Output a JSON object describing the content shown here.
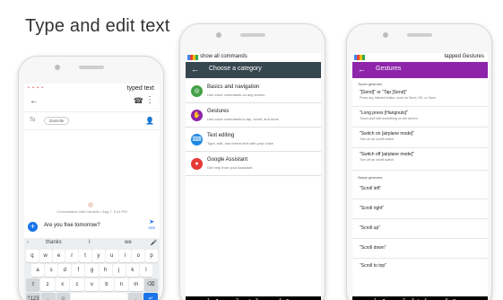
{
  "headline": "Type and edit text",
  "phone1": {
    "overlay_text": "typed text",
    "to_label": "To",
    "recipient_chip": "Danielle",
    "conversation_note": "Conversation with Danielle • Aug 7, 5:44 PM",
    "message_draft": "Are you free tomorrow?",
    "send_label": "SMS",
    "suggestions": [
      "thanks",
      "I",
      "we"
    ],
    "keyboard": {
      "row1": [
        "q",
        "w",
        "e",
        "r",
        "t",
        "y",
        "u",
        "i",
        "o",
        "p"
      ],
      "row2": [
        "a",
        "s",
        "d",
        "f",
        "g",
        "h",
        "j",
        "k",
        "l"
      ],
      "row3": [
        "⇧",
        "z",
        "x",
        "c",
        "v",
        "b",
        "n",
        "m",
        "⌫"
      ],
      "row4": [
        "?123",
        ",",
        "☺",
        "",
        ".",
        " ↵"
      ]
    }
  },
  "phone2": {
    "top_text": "show all commands",
    "title": "Choose a category",
    "categories": [
      {
        "title": "Basics and navigation",
        "desc": "Use voice commands on any screen",
        "color": "#43a047",
        "icon": "compass-icon"
      },
      {
        "title": "Gestures",
        "desc": "Use voice commands to tap, scroll, and more",
        "color": "#8e24aa",
        "icon": "hand-icon"
      },
      {
        "title": "Text editing",
        "desc": "Type, edit, and format text with your voice",
        "color": "#1e88e5",
        "icon": "keyboard-icon"
      },
      {
        "title": "Google Assistant",
        "desc": "Get help from your Assistant",
        "color": "#e53935",
        "icon": "assistant-icon"
      }
    ],
    "nav_numbers": [
      "1",
      "2",
      "3",
      "4"
    ]
  },
  "phone3": {
    "top_text": "tapped Gestures",
    "title": "Gestures",
    "touch_heading": "Touch gestures",
    "commands": [
      {
        "cmd": "\"[Send]\" or \"Tap [Send]\"",
        "desc": "Press any labeled button, such as Send, OK, or Save"
      },
      {
        "cmd": "\"Long press [Hangouts]\"",
        "desc": "Touch and hold something on the screen"
      },
      {
        "cmd": "\"Switch on [airplane mode]\"",
        "desc": "Turn on an on/off switch"
      },
      {
        "cmd": "\"Switch off [airplane mode]\"",
        "desc": "Turn off an on/off switch"
      }
    ],
    "swipe_heading": "Swipe gestures",
    "swipes": [
      "\"Scroll left\"",
      "\"Scroll right\"",
      "\"Scroll up\"",
      "\"Scroll down\"",
      "\"Scroll to top\""
    ],
    "nav_numbers": [
      "1",
      "2",
      "3",
      "4",
      "5"
    ]
  }
}
